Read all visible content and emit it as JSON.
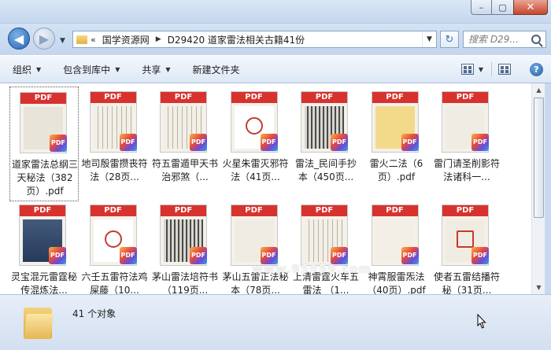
{
  "window": {
    "minimize": "–",
    "maximize": "▢",
    "close": "✕"
  },
  "nav": {
    "back": "◀",
    "forward": "▶",
    "recent_drop": "▼",
    "breadcrumb_prefix": "«",
    "breadcrumb": [
      "国学资源网",
      "D29420 道家雷法相关古籍41份"
    ],
    "crumb_sep": "▶",
    "refresh": "↻",
    "search_placeholder": "搜索 D29..."
  },
  "toolbar": {
    "organize": "组织",
    "include_library": "包含到库中",
    "share": "共享",
    "new_folder": "新建文件夹",
    "help": "?"
  },
  "files": [
    {
      "label": "道家雷法总纲三天秘法（382页）.pdf",
      "art": "title",
      "selected": true
    },
    {
      "label": "地司殷雷攒丧符法（28页...",
      "art": "text"
    },
    {
      "label": "符五雷遁甲天书 治邪煞（...",
      "art": "text"
    },
    {
      "label": "火星朱雷灭邪符法（41页...",
      "art": "seal"
    },
    {
      "label": "雷法_民间手抄本（450页...",
      "art": "dark"
    },
    {
      "label": "雷火二法（6页）.pdf",
      "art": "yellow"
    },
    {
      "label": "雷门请圣削影符法诸科一...",
      "art": "plain"
    },
    {
      "label": "灵宝混元雷霆秘传混炼法...",
      "art": "blue"
    },
    {
      "label": "六壬五雷符法鸡屎藤（10...",
      "art": "seal"
    },
    {
      "label": "茅山雷法培符书（119页...",
      "art": "dark"
    },
    {
      "label": "茅山五雷正法秘本（78页...",
      "art": "plain"
    },
    {
      "label": "上清雷霆火车五雷法 （1...",
      "art": "text"
    },
    {
      "label": "神霄服雷炁法（40页）.pdf",
      "art": "pale"
    },
    {
      "label": "使者五雷结播符秘（31页...",
      "art": "redseal"
    }
  ],
  "pdf_band": "PDF",
  "pdf_badge": "PDF",
  "watermark": "www.95959.com",
  "status": {
    "count": "41 个对象"
  }
}
